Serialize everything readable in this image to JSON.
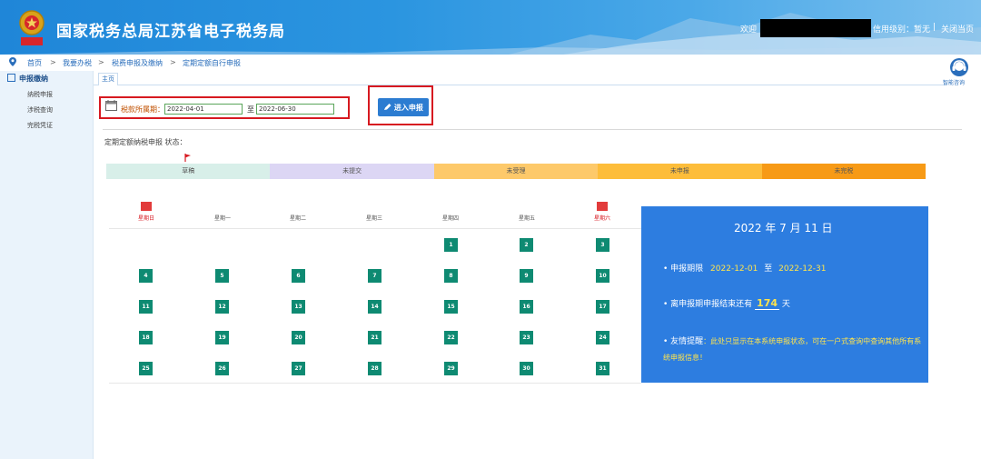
{
  "header": {
    "site_title": "国家税务总局江苏省电子税务局",
    "welcome": "欢迎",
    "credit_text": "信用级别：暂无",
    "separator": "|",
    "close_link": "关闭当页",
    "emblem_text": "中国税务"
  },
  "breadcrumb": {
    "items": [
      "首页",
      "我要办税",
      "税费申报及缴纳",
      "定期定额自行申报"
    ],
    "separator": ">"
  },
  "sidebar": {
    "section": "申报缴纳",
    "items": [
      "纳税申报",
      "涉税查询",
      "完税凭证"
    ]
  },
  "tabs": {
    "main": "主页"
  },
  "assistant": {
    "label": "智能咨询"
  },
  "period": {
    "label": "税款所属期：",
    "start": "2022-04-01",
    "to": "至",
    "end": "2022-06-30"
  },
  "enter_button": "进入申报",
  "status": {
    "title": "定期定额纳税申报 状态：",
    "segments": [
      {
        "label": "草稿",
        "color": "#d8efe9"
      },
      {
        "label": "未提交",
        "color": "#dcd6f4"
      },
      {
        "label": "未受理",
        "color": "#fdc96a"
      },
      {
        "label": "未申报",
        "color": "#fdbd3a"
      },
      {
        "label": "未完税",
        "color": "#f79a16"
      }
    ]
  },
  "calendar": {
    "weekdays": [
      "星期日",
      "星期一",
      "星期二",
      "星期三",
      "星期四",
      "星期五",
      "星期六"
    ],
    "weeks": [
      [
        "",
        "",
        "",
        "",
        "1",
        "2",
        "3"
      ],
      [
        "4",
        "5",
        "6",
        "7",
        "8",
        "9",
        "10"
      ],
      [
        "11",
        "12",
        "13",
        "14",
        "15",
        "16",
        "17"
      ],
      [
        "18",
        "19",
        "20",
        "21",
        "22",
        "23",
        "24"
      ],
      [
        "25",
        "26",
        "27",
        "28",
        "29",
        "30",
        "31"
      ]
    ]
  },
  "info_panel": {
    "date": "2022 年 7 月 11 日",
    "period_label": "• 申报期限",
    "period_start": "2022-12-01",
    "period_to": "至",
    "period_end": "2022-12-31",
    "countdown_pre": "• 离申报期申报结束还有",
    "countdown_days": "174",
    "countdown_post": "天",
    "tip_label": "• 友情提醒",
    "tip_text": "：此处只显示在本系统申报状态，可在一户式查询中查询其他所有系统申报信息！"
  }
}
